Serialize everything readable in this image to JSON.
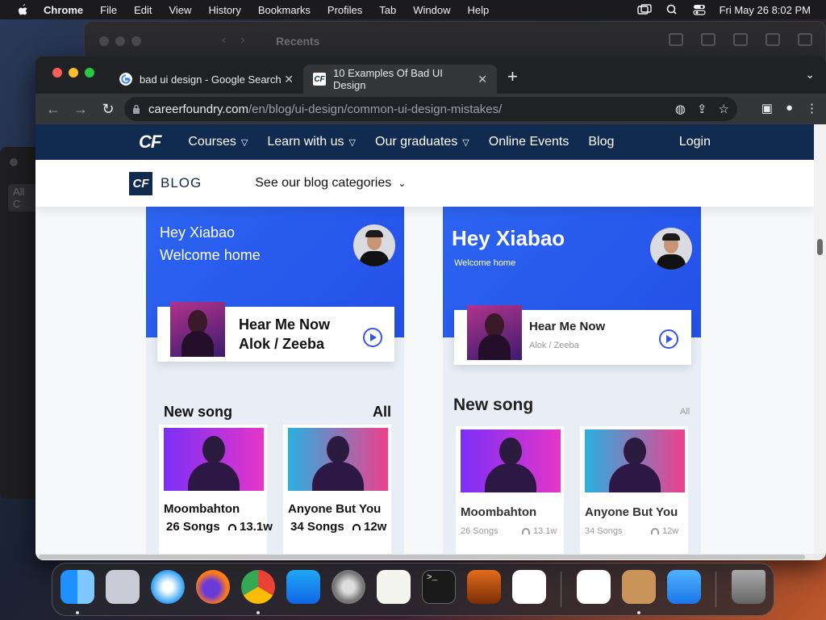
{
  "menubar": {
    "app_name": "Chrome",
    "items": [
      "File",
      "Edit",
      "View",
      "History",
      "Bookmarks",
      "Profiles",
      "Tab",
      "Window",
      "Help"
    ],
    "datetime": "Fri May 26  8:02 PM"
  },
  "background_window": {
    "title": "Recents"
  },
  "background_window_left": {
    "label": "All C"
  },
  "browser": {
    "tabs": [
      {
        "title": "bad ui design - Google Search",
        "favicon": "google-icon",
        "active": false
      },
      {
        "title": "10 Examples Of Bad UI Design",
        "favicon": "careerfoundry-icon",
        "active": true
      }
    ],
    "url_domain": "careerfoundry.com",
    "url_path": "/en/blog/ui-design/common-ui-design-mistakes/"
  },
  "site_nav": {
    "logo": "CF",
    "items": [
      {
        "label": "Courses",
        "has_dropdown": true
      },
      {
        "label": "Learn with us",
        "has_dropdown": true
      },
      {
        "label": "Our graduates",
        "has_dropdown": true
      },
      {
        "label": "Online Events",
        "has_dropdown": false
      },
      {
        "label": "Blog",
        "has_dropdown": false
      }
    ],
    "login": "Login"
  },
  "blog_bar": {
    "logo": "CF",
    "word": "BLOG",
    "categories_label": "See our blog categories"
  },
  "mockups": {
    "left": {
      "greeting_line1": "Hey Xiabao",
      "greeting_line2": "Welcome home",
      "now_playing_title": "Hear Me Now",
      "now_playing_artist": "Alok / Zeeba",
      "section_title": "New song",
      "section_link": "All",
      "songs": [
        {
          "title": "Moombahton",
          "count": "26 Songs",
          "plays": "13.1w"
        },
        {
          "title": "Anyone But You",
          "count": "34 Songs",
          "plays": "12w"
        }
      ]
    },
    "right": {
      "greeting_line1": "Hey Xiabao",
      "greeting_line2": "Welcome home",
      "now_playing_title": "Hear Me Now",
      "now_playing_artist": "Alok / Zeeba",
      "section_title": "New song",
      "section_link": "All",
      "songs": [
        {
          "title": "Moombahton",
          "count": "26 Songs",
          "plays": "13.1w"
        },
        {
          "title": "Anyone But You",
          "count": "34 Songs",
          "plays": "12w"
        }
      ]
    }
  },
  "dock": {
    "apps": [
      "finder-icon",
      "launchpad-icon",
      "safari-icon",
      "firefox-icon",
      "chrome-icon",
      "app-store-icon",
      "system-settings-icon",
      "textedit-icon",
      "terminal-icon",
      "garageband-icon",
      "vscode-icon",
      "visual-studio-icon",
      "contacts-icon",
      "mail-icon",
      "trash-icon"
    ]
  },
  "colors": {
    "cf_navy": "#112a4f",
    "mock_blue": "#2c64f0",
    "chrome_dark": "#202124",
    "chrome_toolbar": "#35363a"
  }
}
